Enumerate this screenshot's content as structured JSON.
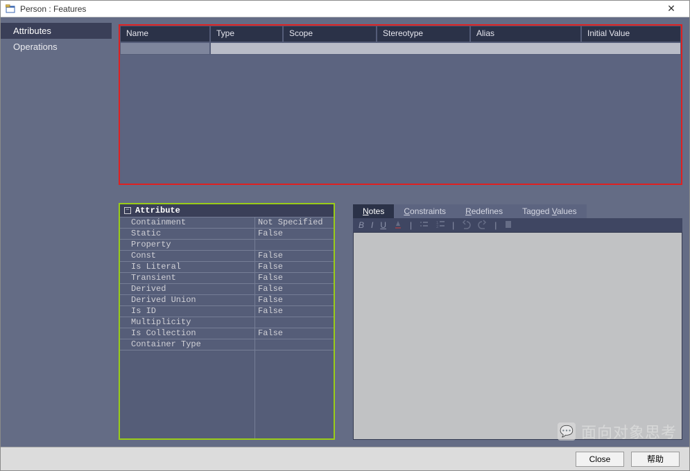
{
  "window": {
    "title": "Person : Features"
  },
  "sidebar": {
    "items": [
      {
        "label": "Attributes",
        "active": true
      },
      {
        "label": "Operations",
        "active": false
      }
    ]
  },
  "grid": {
    "columns": [
      "Name",
      "Type",
      "Scope",
      "Stereotype",
      "Alias",
      "Initial Value"
    ]
  },
  "properties": {
    "header": "Attribute",
    "rows": [
      {
        "key": "Containment",
        "value": "Not Specified"
      },
      {
        "key": "Static",
        "value": "False"
      },
      {
        "key": "Property",
        "value": ""
      },
      {
        "key": "Const",
        "value": "False"
      },
      {
        "key": "Is Literal",
        "value": "False"
      },
      {
        "key": "Transient",
        "value": "False"
      },
      {
        "key": "Derived",
        "value": "False"
      },
      {
        "key": "Derived Union",
        "value": "False"
      },
      {
        "key": "Is ID",
        "value": "False"
      },
      {
        "key": "Multiplicity",
        "value": ""
      },
      {
        "key": "Is Collection",
        "value": "False"
      },
      {
        "key": "Container Type",
        "value": ""
      }
    ]
  },
  "tabs": {
    "items": [
      {
        "pre": "",
        "u": "N",
        "post": "otes",
        "active": true
      },
      {
        "pre": "",
        "u": "C",
        "post": "onstraints",
        "active": false
      },
      {
        "pre": "",
        "u": "R",
        "post": "edefines",
        "active": false
      },
      {
        "pre": "Tagged ",
        "u": "V",
        "post": "alues",
        "active": false
      }
    ]
  },
  "footer": {
    "buttons": [
      {
        "label": "Close"
      },
      {
        "label": "帮助"
      }
    ]
  },
  "watermark": {
    "text": "面向对象思考"
  }
}
